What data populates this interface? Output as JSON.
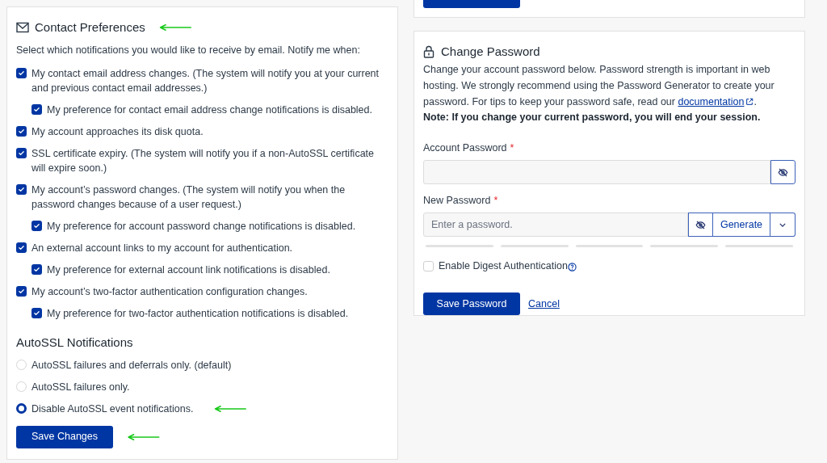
{
  "contact_preferences": {
    "title": "Contact Preferences",
    "intro": "Select which notifications you would like to receive by email. Notify me when:",
    "options": [
      {
        "label": "My contact email address changes. (The system will notify you at your current and previous contact email addresses.)",
        "checked": true,
        "children": [
          {
            "label": "My preference for contact email address change notifications is disabled.",
            "checked": true
          }
        ]
      },
      {
        "label": "My account approaches its disk quota.",
        "checked": true
      },
      {
        "label": "SSL certificate expiry. (The system will notify you if a non-AutoSSL certificate will expire soon.)",
        "checked": true
      },
      {
        "label": "My account’s password changes. (The system will notify you when the password changes because of a user request.)",
        "checked": true,
        "children": [
          {
            "label": "My preference for account password change notifications is disabled.",
            "checked": true
          }
        ]
      },
      {
        "label": "An external account links to my account for authentication.",
        "checked": true,
        "children": [
          {
            "label": "My preference for external account link notifications is disabled.",
            "checked": true
          }
        ]
      },
      {
        "label": "My account’s two-factor authentication configuration changes.",
        "checked": true,
        "children": [
          {
            "label": "My preference for two-factor authentication notifications is disabled.",
            "checked": true
          }
        ]
      }
    ],
    "autossl": {
      "title": "AutoSSL Notifications",
      "options": [
        {
          "label": "AutoSSL failures and deferrals only. (default)",
          "selected": false
        },
        {
          "label": "AutoSSL failures only.",
          "selected": false
        },
        {
          "label": "Disable AutoSSL event notifications.",
          "selected": true
        }
      ]
    },
    "save_button": "Save Changes"
  },
  "change_password": {
    "title": "Change Password",
    "description": "Change your account password below. Password strength is important in web hosting. We strongly recommend using the Password Generator to create your password. For tips to keep your password safe, read our ",
    "link": "documentation",
    "description_end": ".",
    "note": "Note: If you change your current password, you will end your session.",
    "account_password": {
      "label": "Account Password",
      "required_mark": "*"
    },
    "new_password": {
      "label": "New Password",
      "required_mark": "*",
      "placeholder": "Enter a password."
    },
    "generate_button": "Generate",
    "strength": {
      "level": 0
    },
    "digest": {
      "label": "Enable Digest Authentication",
      "checked": false
    },
    "save_button": "Save Password",
    "cancel_link": "Cancel"
  }
}
